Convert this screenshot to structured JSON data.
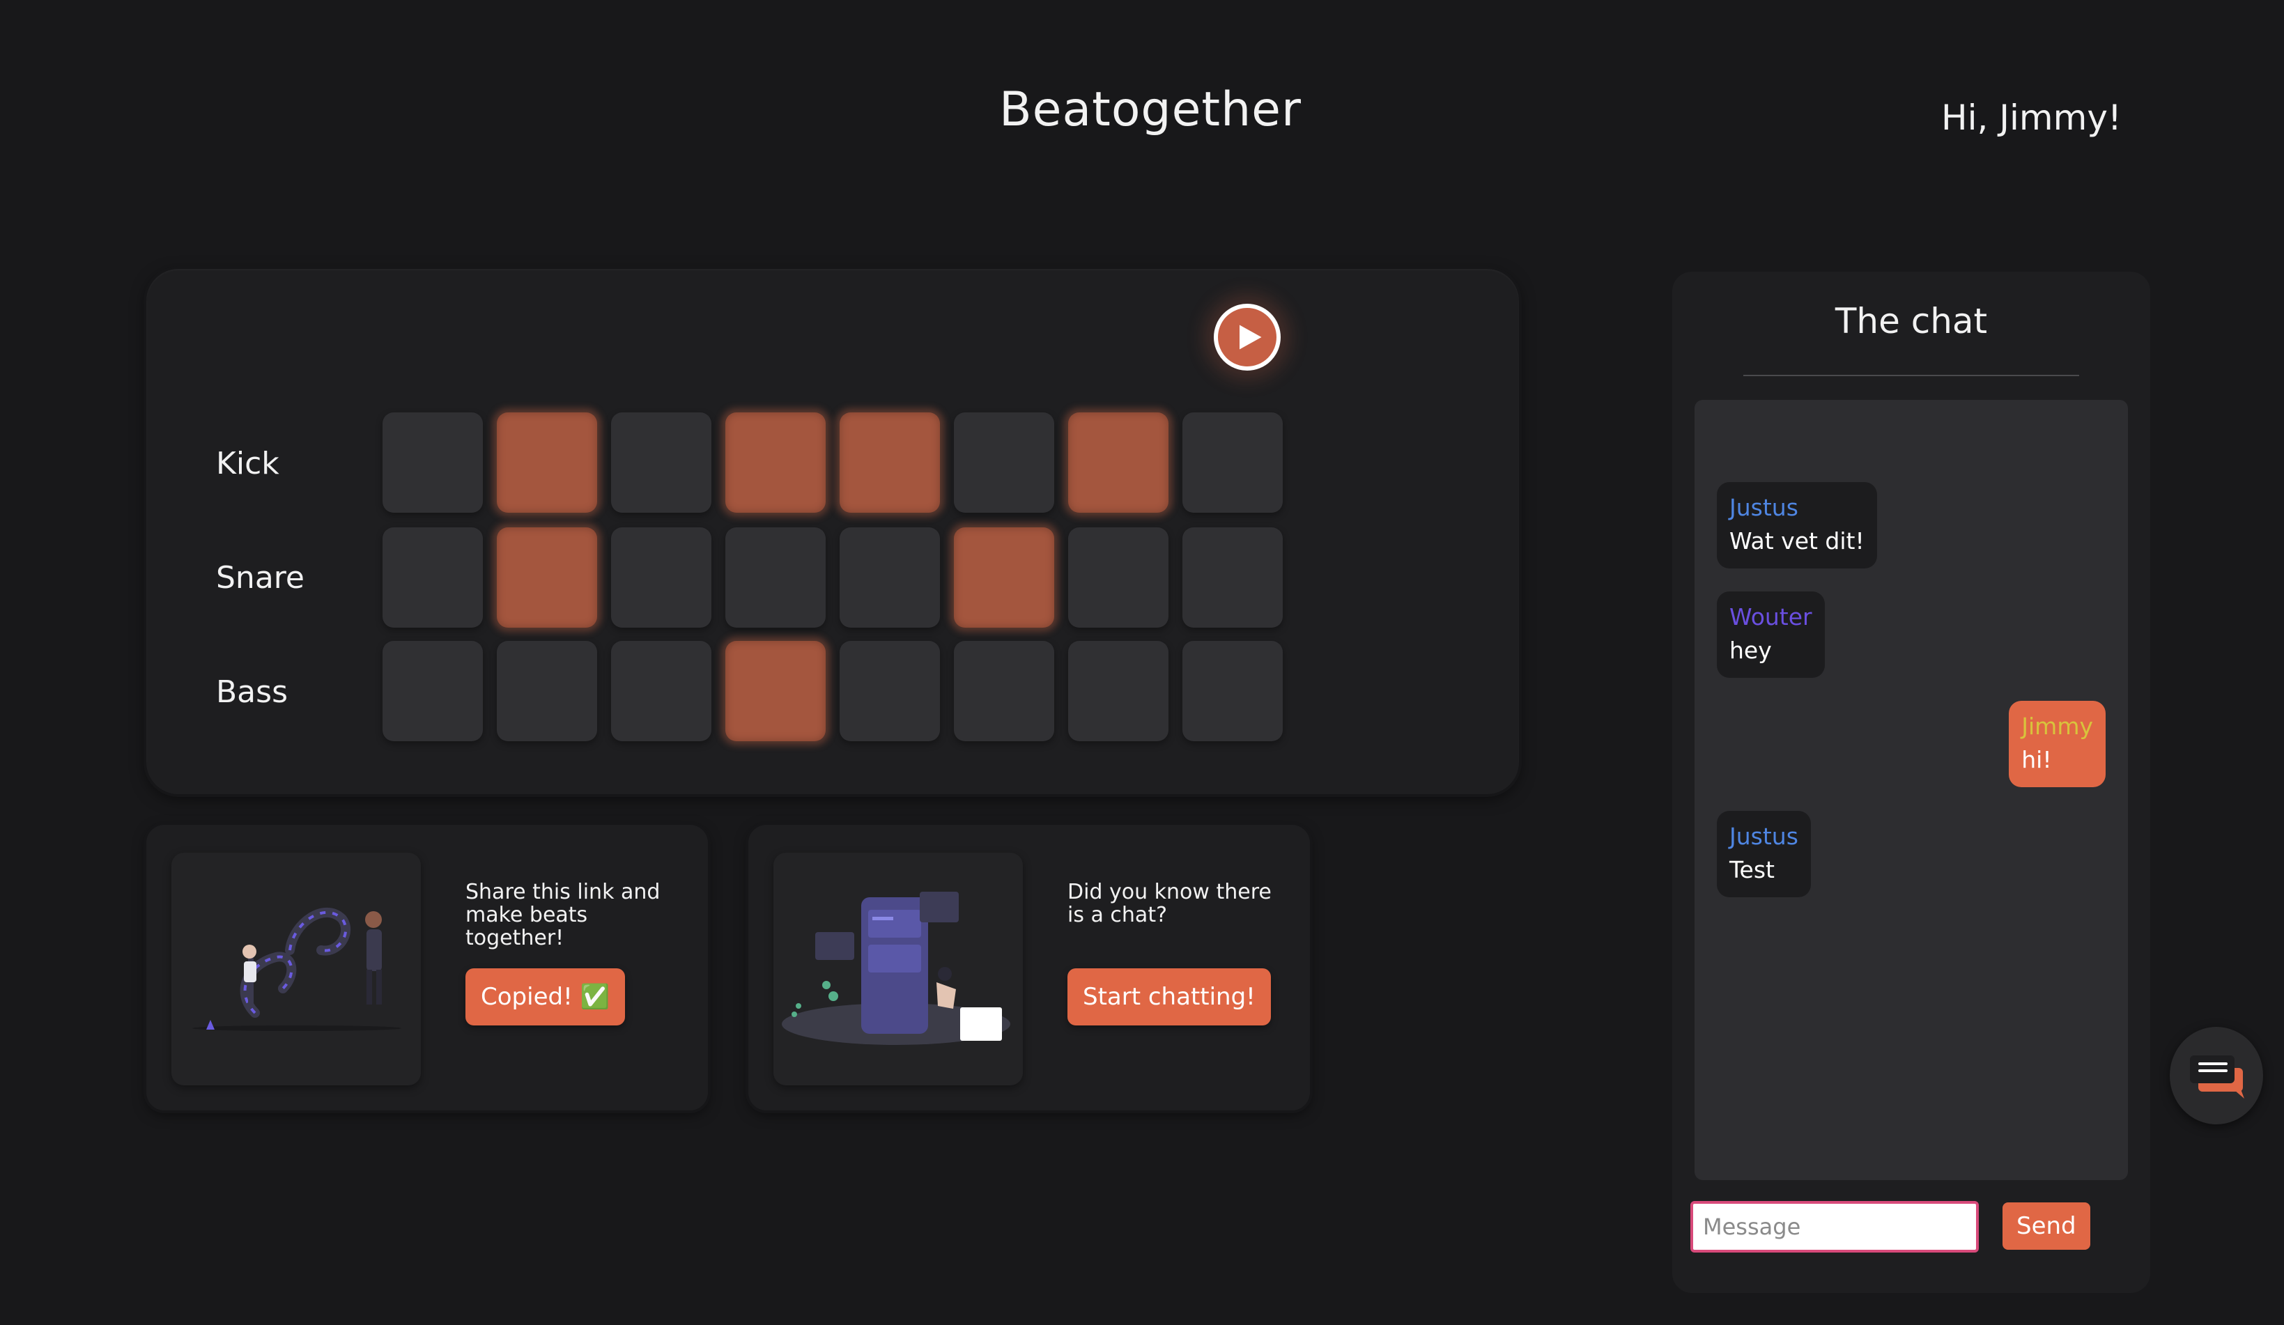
{
  "header": {
    "app_title": "Beatogether",
    "greeting": "Hi, Jimmy!"
  },
  "sequencer": {
    "play_icon": "play-icon",
    "rows": [
      {
        "label": "Kick",
        "steps": [
          false,
          true,
          false,
          true,
          true,
          false,
          true,
          false
        ]
      },
      {
        "label": "Snare",
        "steps": [
          false,
          true,
          false,
          false,
          false,
          true,
          false,
          false
        ]
      },
      {
        "label": "Bass",
        "steps": [
          false,
          false,
          false,
          true,
          false,
          false,
          false,
          false
        ]
      }
    ],
    "active_color": "#a4563e",
    "inactive_color": "#303033"
  },
  "cards": [
    {
      "text": "Share this link and make beats together!",
      "button_label": "Copied! ✅",
      "illustration": "link-illustration"
    },
    {
      "text": "Did you know there is a chat?",
      "button_label": "Start chatting!",
      "illustration": "chat-phone-illustration"
    }
  ],
  "chat": {
    "title": "The chat",
    "messages": [
      {
        "author": "Justus",
        "text": "Wat vet dit!",
        "author_color": "#4f86e3",
        "mine": false
      },
      {
        "author": "Wouter",
        "text": "hey",
        "author_color": "#6a4fe0",
        "mine": false
      },
      {
        "author": "Jimmy",
        "text": "hi!",
        "author_color": "#d8c33c",
        "mine": true
      },
      {
        "author": "Justus",
        "text": "Test",
        "author_color": "#4f86e3",
        "mine": false
      }
    ],
    "input_placeholder": "Message",
    "input_value": "",
    "send_label": "Send",
    "toggle_icon": "chat-bubble-icon"
  },
  "colors": {
    "accent": "#e06745",
    "background": "#18181a",
    "panel": "#1e1e20"
  }
}
